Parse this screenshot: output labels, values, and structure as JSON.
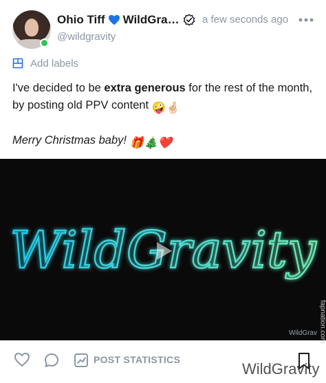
{
  "header": {
    "display_name": "Ohio Tiff",
    "display_name_suffix": "WildGra…",
    "timestamp": "a few seconds ago",
    "handle": "@wildgravity",
    "online": true
  },
  "labels": {
    "add_labels": "Add labels"
  },
  "post": {
    "line1_prefix": "I've decided to be ",
    "line1_bold": "extra generous",
    "line1_suffix": " for the rest of the month, by posting old PPV content ",
    "line1_emojis": "🤪🤞🏻",
    "line2": "Merry Christmas baby! ",
    "line2_emojis": "🎁🎄❤️"
  },
  "media": {
    "logo_text": "WildGravity",
    "corner_watermark": "WildGrav",
    "side_watermark": "fapnation.com"
  },
  "actions": {
    "stats_label": "POST STATISTICS"
  },
  "footer": {
    "brand_watermark": "WildGravity"
  },
  "colors": {
    "muted": "#8a96a3",
    "online": "#35c15a",
    "neon_start": "#21c8e8",
    "neon_end": "#6ee7b0",
    "accent_blue": "#1d73e8"
  }
}
